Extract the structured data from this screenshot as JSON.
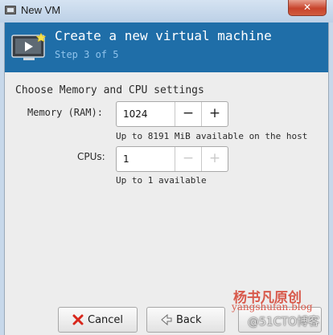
{
  "window": {
    "title": "New VM",
    "close_glyph": "✕"
  },
  "banner": {
    "title": "Create a new virtual machine",
    "step": "Step 3 of 5",
    "icon": "vm-display-icon"
  },
  "section": {
    "title": "Choose Memory and CPU settings"
  },
  "memory": {
    "label": "Memory (RAM):",
    "value": "1024",
    "minus": "−",
    "plus": "+",
    "hint": "Up to 8191 MiB available on the host"
  },
  "cpus": {
    "label": "CPUs:",
    "value": "1",
    "minus": "−",
    "plus": "+",
    "hint": "Up to 1 available"
  },
  "buttons": {
    "cancel": "Cancel",
    "back": "Back"
  },
  "watermark": {
    "line1": "杨书凡原创",
    "line2": "yangshufan.blog",
    "line3": "@51CTO博客"
  },
  "colors": {
    "banner": "#1f6ea8",
    "step_text": "#8fc3ec",
    "close": "#c8442c"
  }
}
